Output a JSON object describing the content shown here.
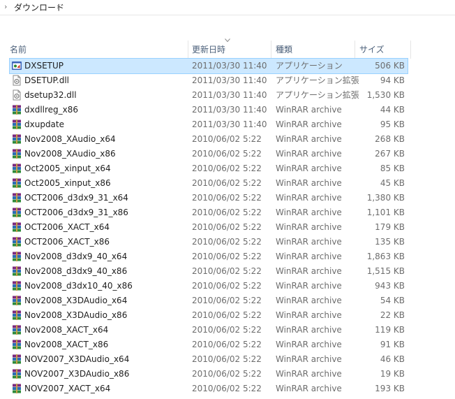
{
  "breadcrumb": {
    "folder": "ダウンロード"
  },
  "columns": {
    "name": "名前",
    "date": "更新日時",
    "type": "種類",
    "size": "サイズ"
  },
  "files": [
    {
      "name": "DXSETUP",
      "date": "2011/03/30 11:40",
      "type": "アプリケーション",
      "size": "506 KB",
      "icon": "application-icon",
      "selected": true
    },
    {
      "name": "DSETUP.dll",
      "date": "2011/03/30 11:40",
      "type": "アプリケーション拡張",
      "size": "94 KB",
      "icon": "dll-file-icon"
    },
    {
      "name": "dsetup32.dll",
      "date": "2011/03/30 11:40",
      "type": "アプリケーション拡張",
      "size": "1,530 KB",
      "icon": "dll-file-icon"
    },
    {
      "name": "dxdllreg_x86",
      "date": "2011/03/30 11:40",
      "type": "WinRAR archive",
      "size": "44 KB",
      "icon": "winrar-archive-icon"
    },
    {
      "name": "dxupdate",
      "date": "2011/03/30 11:40",
      "type": "WinRAR archive",
      "size": "95 KB",
      "icon": "winrar-archive-icon"
    },
    {
      "name": "Nov2008_XAudio_x64",
      "date": "2010/06/02 5:22",
      "type": "WinRAR archive",
      "size": "268 KB",
      "icon": "winrar-archive-icon"
    },
    {
      "name": "Nov2008_XAudio_x86",
      "date": "2010/06/02 5:22",
      "type": "WinRAR archive",
      "size": "267 KB",
      "icon": "winrar-archive-icon"
    },
    {
      "name": "Oct2005_xinput_x64",
      "date": "2010/06/02 5:22",
      "type": "WinRAR archive",
      "size": "85 KB",
      "icon": "winrar-archive-icon"
    },
    {
      "name": "Oct2005_xinput_x86",
      "date": "2010/06/02 5:22",
      "type": "WinRAR archive",
      "size": "45 KB",
      "icon": "winrar-archive-icon"
    },
    {
      "name": "OCT2006_d3dx9_31_x64",
      "date": "2010/06/02 5:22",
      "type": "WinRAR archive",
      "size": "1,380 KB",
      "icon": "winrar-archive-icon"
    },
    {
      "name": "OCT2006_d3dx9_31_x86",
      "date": "2010/06/02 5:22",
      "type": "WinRAR archive",
      "size": "1,101 KB",
      "icon": "winrar-archive-icon"
    },
    {
      "name": "OCT2006_XACT_x64",
      "date": "2010/06/02 5:22",
      "type": "WinRAR archive",
      "size": "179 KB",
      "icon": "winrar-archive-icon"
    },
    {
      "name": "OCT2006_XACT_x86",
      "date": "2010/06/02 5:22",
      "type": "WinRAR archive",
      "size": "135 KB",
      "icon": "winrar-archive-icon"
    },
    {
      "name": "Nov2008_d3dx9_40_x64",
      "date": "2010/06/02 5:22",
      "type": "WinRAR archive",
      "size": "1,863 KB",
      "icon": "winrar-archive-icon"
    },
    {
      "name": "Nov2008_d3dx9_40_x86",
      "date": "2010/06/02 5:22",
      "type": "WinRAR archive",
      "size": "1,515 KB",
      "icon": "winrar-archive-icon"
    },
    {
      "name": "Nov2008_d3dx10_40_x86",
      "date": "2010/06/02 5:22",
      "type": "WinRAR archive",
      "size": "943 KB",
      "icon": "winrar-archive-icon"
    },
    {
      "name": "Nov2008_X3DAudio_x64",
      "date": "2010/06/02 5:22",
      "type": "WinRAR archive",
      "size": "54 KB",
      "icon": "winrar-archive-icon"
    },
    {
      "name": "Nov2008_X3DAudio_x86",
      "date": "2010/06/02 5:22",
      "type": "WinRAR archive",
      "size": "22 KB",
      "icon": "winrar-archive-icon"
    },
    {
      "name": "Nov2008_XACT_x64",
      "date": "2010/06/02 5:22",
      "type": "WinRAR archive",
      "size": "119 KB",
      "icon": "winrar-archive-icon"
    },
    {
      "name": "Nov2008_XACT_x86",
      "date": "2010/06/02 5:22",
      "type": "WinRAR archive",
      "size": "91 KB",
      "icon": "winrar-archive-icon"
    },
    {
      "name": "NOV2007_X3DAudio_x64",
      "date": "2010/06/02 5:22",
      "type": "WinRAR archive",
      "size": "46 KB",
      "icon": "winrar-archive-icon"
    },
    {
      "name": "NOV2007_X3DAudio_x86",
      "date": "2010/06/02 5:22",
      "type": "WinRAR archive",
      "size": "19 KB",
      "icon": "winrar-archive-icon"
    },
    {
      "name": "NOV2007_XACT_x64",
      "date": "2010/06/02 5:22",
      "type": "WinRAR archive",
      "size": "193 KB",
      "icon": "winrar-archive-icon"
    }
  ],
  "colors": {
    "selection_bg": "#cce8ff",
    "selection_border": "#99d1ff",
    "header_text": "#4c607a",
    "detail_text": "#6d6d6d"
  }
}
